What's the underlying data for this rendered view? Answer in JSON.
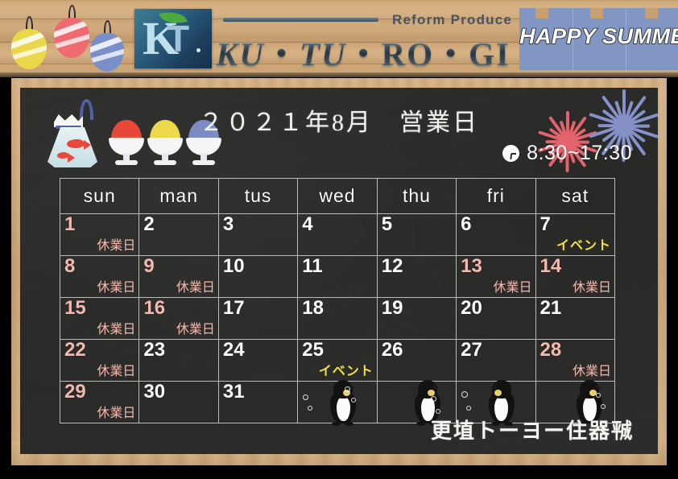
{
  "header": {
    "logo_letters": {
      "k": "K",
      "t": "T"
    },
    "tagline": "Reform Produce",
    "brand": "KU・TU・RO・GI",
    "brand_parts": {
      "ku": "KU",
      "sep1": "・",
      "tu": "TU",
      "sep2": "・",
      "ro": "RO",
      "sep3": "・",
      "gi": "GI"
    },
    "summer_banner": "HAPPY SUMMER"
  },
  "board": {
    "title": "２０２１年8月　営業日",
    "hours": "8:30~17:30",
    "shop_name": "更埴トーヨー住器㍻"
  },
  "calendar": {
    "weekday_headers": [
      "sun",
      "man",
      "tus",
      "wed",
      "thu",
      "fri",
      "sat"
    ],
    "labels": {
      "closed": "休業日",
      "event": "イベント"
    },
    "weeks": [
      [
        {
          "day": "1",
          "note": "休業日",
          "type": "closed"
        },
        {
          "day": "2",
          "note": "",
          "type": "open"
        },
        {
          "day": "3",
          "note": "",
          "type": "open"
        },
        {
          "day": "4",
          "note": "",
          "type": "open"
        },
        {
          "day": "5",
          "note": "",
          "type": "open"
        },
        {
          "day": "6",
          "note": "",
          "type": "open"
        },
        {
          "day": "7",
          "note": "イベント",
          "type": "event"
        }
      ],
      [
        {
          "day": "8",
          "note": "休業日",
          "type": "closed"
        },
        {
          "day": "9",
          "note": "休業日",
          "type": "closed"
        },
        {
          "day": "10",
          "note": "",
          "type": "open"
        },
        {
          "day": "11",
          "note": "",
          "type": "open"
        },
        {
          "day": "12",
          "note": "",
          "type": "open"
        },
        {
          "day": "13",
          "note": "休業日",
          "type": "closed"
        },
        {
          "day": "14",
          "note": "休業日",
          "type": "closed"
        }
      ],
      [
        {
          "day": "15",
          "note": "休業日",
          "type": "closed"
        },
        {
          "day": "16",
          "note": "休業日",
          "type": "closed"
        },
        {
          "day": "17",
          "note": "",
          "type": "open"
        },
        {
          "day": "18",
          "note": "",
          "type": "open"
        },
        {
          "day": "19",
          "note": "",
          "type": "open"
        },
        {
          "day": "20",
          "note": "",
          "type": "open"
        },
        {
          "day": "21",
          "note": "",
          "type": "open"
        }
      ],
      [
        {
          "day": "22",
          "note": "休業日",
          "type": "closed"
        },
        {
          "day": "23",
          "note": "",
          "type": "open"
        },
        {
          "day": "24",
          "note": "",
          "type": "open"
        },
        {
          "day": "25",
          "note": "イベント",
          "type": "event"
        },
        {
          "day": "26",
          "note": "",
          "type": "open"
        },
        {
          "day": "27",
          "note": "",
          "type": "open"
        },
        {
          "day": "28",
          "note": "休業日",
          "type": "closed"
        }
      ],
      [
        {
          "day": "29",
          "note": "休業日",
          "type": "closed"
        },
        {
          "day": "30",
          "note": "",
          "type": "open"
        },
        {
          "day": "31",
          "note": "",
          "type": "open"
        },
        {
          "day": "",
          "note": "",
          "type": "empty"
        },
        {
          "day": "",
          "note": "",
          "type": "empty"
        },
        {
          "day": "",
          "note": "",
          "type": "empty"
        },
        {
          "day": "",
          "note": "",
          "type": "empty"
        }
      ]
    ]
  },
  "colors": {
    "closed_pink": "#f3b8ae",
    "event_yellow": "#f5e03c",
    "chalkboard": "#2c2c2a",
    "wood_frame": "#c9a070",
    "banner_blue": "#8296c4",
    "balloon_yellow": "#ead84a",
    "balloon_red": "#ef6a71",
    "balloon_blue": "#7a8ec9",
    "ice_red": "#e8483a",
    "ice_yellow": "#ecd94a",
    "ice_blue": "#7b8cc4",
    "firework_red": "#e2636b",
    "firework_blue": "#8592c9"
  },
  "decorations": {
    "balloons": [
      "yoyo-balloon-yellow",
      "yoyo-balloon-red",
      "yoyo-balloon-blue"
    ],
    "goldfish_bag": "goldfish-bag",
    "shaved_ice": [
      "shaved-ice-red",
      "shaved-ice-yellow",
      "shaved-ice-blue"
    ],
    "fireworks": [
      "firework-red",
      "firework-blue"
    ],
    "penguins": 4
  }
}
